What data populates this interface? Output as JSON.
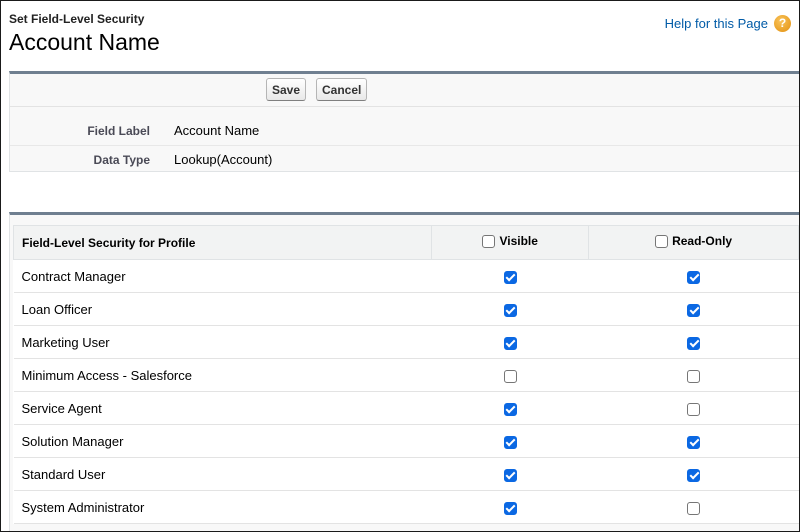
{
  "header": {
    "subtitle": "Set Field-Level Security",
    "title": "Account Name",
    "help_link": "Help for this Page",
    "help_icon": "question-icon"
  },
  "buttons": {
    "save": "Save",
    "cancel": "Cancel"
  },
  "fields": [
    {
      "label": "Field Label",
      "value": "Account Name"
    },
    {
      "label": "Data Type",
      "value": "Lookup(Account)"
    }
  ],
  "table": {
    "headers": {
      "profile": "Field-Level Security for Profile",
      "visible": "Visible",
      "read_only": "Read-Only"
    },
    "header_checkboxes": {
      "visible": false,
      "read_only": false
    },
    "rows": [
      {
        "profile": "Contract Manager",
        "visible": true,
        "read_only": true
      },
      {
        "profile": "Loan Officer",
        "visible": true,
        "read_only": true
      },
      {
        "profile": "Marketing User",
        "visible": true,
        "read_only": true
      },
      {
        "profile": "Minimum Access - Salesforce",
        "visible": false,
        "read_only": false
      },
      {
        "profile": "Service Agent",
        "visible": true,
        "read_only": false
      },
      {
        "profile": "Solution Manager",
        "visible": true,
        "read_only": true
      },
      {
        "profile": "Standard User",
        "visible": true,
        "read_only": true
      },
      {
        "profile": "System Administrator",
        "visible": true,
        "read_only": false
      }
    ]
  },
  "colors": {
    "checkbox_checked": "#0b68e3",
    "link": "#015ba7",
    "panel_border": "#6f7f90"
  }
}
